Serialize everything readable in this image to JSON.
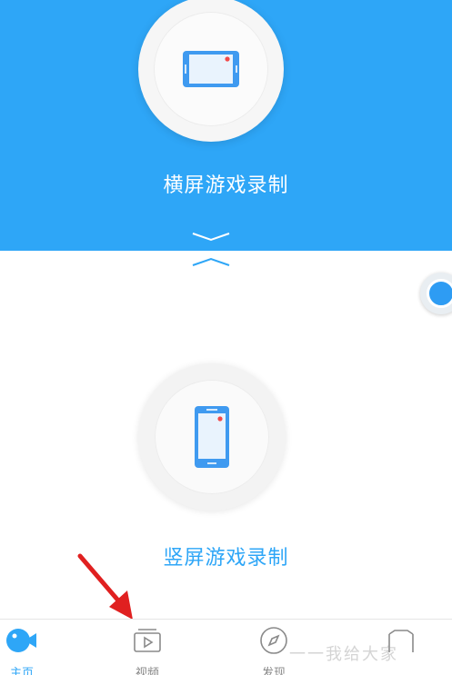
{
  "colors": {
    "accent": "#2ea6f7",
    "record_dot": "#f24a4a",
    "arrow": "#e02020"
  },
  "landscape_mode": {
    "icon": "phone-landscape-icon",
    "label": "横屏游戏录制"
  },
  "portrait_mode": {
    "icon": "phone-portrait-icon",
    "label": "竖屏游戏录制"
  },
  "floating_button": {
    "icon": "record-bubble-icon"
  },
  "bottom_nav": {
    "items": [
      {
        "label": "主页",
        "icon": "home-camera-icon",
        "active": true
      },
      {
        "label": "视频",
        "icon": "video-play-icon",
        "active": false
      },
      {
        "label": "发现",
        "icon": "compass-icon",
        "active": false
      },
      {
        "label": "",
        "icon": "profile-icon",
        "active": false
      }
    ]
  },
  "watermark": {
    "text": "一一我给大家"
  }
}
